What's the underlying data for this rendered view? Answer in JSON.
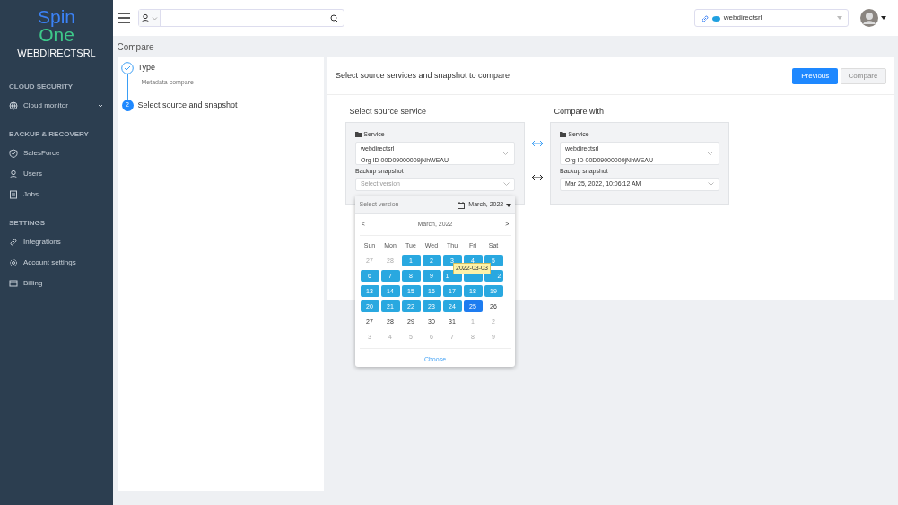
{
  "sidebar": {
    "logo": {
      "line1": "Spin",
      "line2": "One"
    },
    "org": "WEBDIRECTSRL",
    "sections": [
      {
        "title": "CLOUD SECURITY",
        "items": [
          {
            "label": "Cloud monitor",
            "expandable": true
          }
        ]
      },
      {
        "title": "BACKUP & RECOVERY",
        "items": [
          {
            "label": "SalesForce",
            "expandable": false
          },
          {
            "label": "Users",
            "expandable": false
          },
          {
            "label": "Jobs",
            "expandable": false
          }
        ]
      },
      {
        "title": "SETTINGS",
        "items": [
          {
            "label": "Integrations",
            "expandable": false
          },
          {
            "label": "Account settings",
            "expandable": false
          },
          {
            "label": "Billing",
            "expandable": false
          }
        ]
      }
    ]
  },
  "topbar": {
    "account": "webdirectsrl"
  },
  "page_title": "Compare",
  "steps": [
    {
      "title": "Type",
      "subtitle": "Metadata compare",
      "done": true
    },
    {
      "title": "Select source and snapshot",
      "number": "2",
      "done": false
    }
  ],
  "panel": {
    "heading": "Select source services and snapshot to compare",
    "buttons": [
      {
        "label": "Previous",
        "disabled": false
      },
      {
        "label": "Compare",
        "disabled": true
      }
    ],
    "source": {
      "title": "Select source service",
      "service_label": "Service",
      "service": "webdirectsrl",
      "org_id": "Org ID 00D09000009jNhWEAU",
      "snapshot_label": "Backup snapshot",
      "snapshot_placeholder": "Select version"
    },
    "target": {
      "title": "Compare with",
      "service_label": "Service",
      "service": "webdirectsrl",
      "org_id": "Org ID 00D09000009jNhWEAU",
      "snapshot_label": "Backup snapshot",
      "snapshot_value": "Mar 25, 2022, 10:06:12 AM"
    }
  },
  "picker": {
    "placeholder": "Select version",
    "month_button": "March, 2022",
    "month_title": "March, 2022",
    "prev": "<",
    "next": ">",
    "weekdays": [
      "Sun",
      "Mon",
      "Tue",
      "Wed",
      "Thu",
      "Fri",
      "Sat"
    ],
    "days": [
      {
        "label": "27",
        "kind": "muted",
        "selected": false
      },
      {
        "label": "28",
        "kind": "muted",
        "selected": false
      },
      {
        "label": "1",
        "kind": "available",
        "selected": false
      },
      {
        "label": "2",
        "kind": "available",
        "selected": false
      },
      {
        "label": "3",
        "kind": "available",
        "selected": false
      },
      {
        "label": "4",
        "kind": "available",
        "selected": false
      },
      {
        "label": "5",
        "kind": "available",
        "selected": false
      },
      {
        "label": "6",
        "kind": "available",
        "selected": false
      },
      {
        "label": "7",
        "kind": "available",
        "selected": false
      },
      {
        "label": "8",
        "kind": "available",
        "selected": false
      },
      {
        "label": "9",
        "kind": "available",
        "selected": false
      },
      {
        "label": "1",
        "kind": "available",
        "selected": false
      },
      {
        "kind": "available",
        "selected": false
      },
      {
        "label": "2",
        "kind": "available",
        "selected": false
      },
      {
        "label": "13",
        "kind": "available",
        "selected": false
      },
      {
        "label": "14",
        "kind": "available",
        "selected": false
      },
      {
        "label": "15",
        "kind": "available",
        "selected": false
      },
      {
        "label": "16",
        "kind": "available",
        "selected": false
      },
      {
        "label": "17",
        "kind": "available",
        "selected": false
      },
      {
        "label": "18",
        "kind": "available",
        "selected": false
      },
      {
        "label": "19",
        "kind": "available",
        "selected": false
      },
      {
        "label": "20",
        "kind": "available",
        "selected": false
      },
      {
        "label": "21",
        "kind": "available",
        "selected": false
      },
      {
        "label": "22",
        "kind": "available",
        "selected": false
      },
      {
        "label": "23",
        "kind": "available",
        "selected": false
      },
      {
        "label": "24",
        "kind": "available",
        "selected": false
      },
      {
        "label": "25",
        "kind": "available",
        "selected": true
      },
      {
        "label": "26",
        "kind": "plain",
        "selected": false
      },
      {
        "label": "27",
        "kind": "plain",
        "selected": false
      },
      {
        "label": "28",
        "kind": "plain",
        "selected": false
      },
      {
        "label": "29",
        "kind": "plain",
        "selected": false
      },
      {
        "label": "30",
        "kind": "plain",
        "selected": false
      },
      {
        "label": "31",
        "kind": "plain",
        "selected": false
      },
      {
        "label": "1",
        "kind": "muted",
        "selected": false
      },
      {
        "label": "2",
        "kind": "muted",
        "selected": false
      },
      {
        "label": "3",
        "kind": "muted",
        "selected": false
      },
      {
        "label": "4",
        "kind": "muted",
        "selected": false
      },
      {
        "label": "5",
        "kind": "muted",
        "selected": false
      },
      {
        "label": "6",
        "kind": "muted",
        "selected": false
      },
      {
        "label": "7",
        "kind": "muted",
        "selected": false
      },
      {
        "label": "8",
        "kind": "muted",
        "selected": false
      },
      {
        "label": "9",
        "kind": "muted",
        "selected": false
      }
    ],
    "tooltip": "2022-03-03",
    "choose": "Choose"
  }
}
